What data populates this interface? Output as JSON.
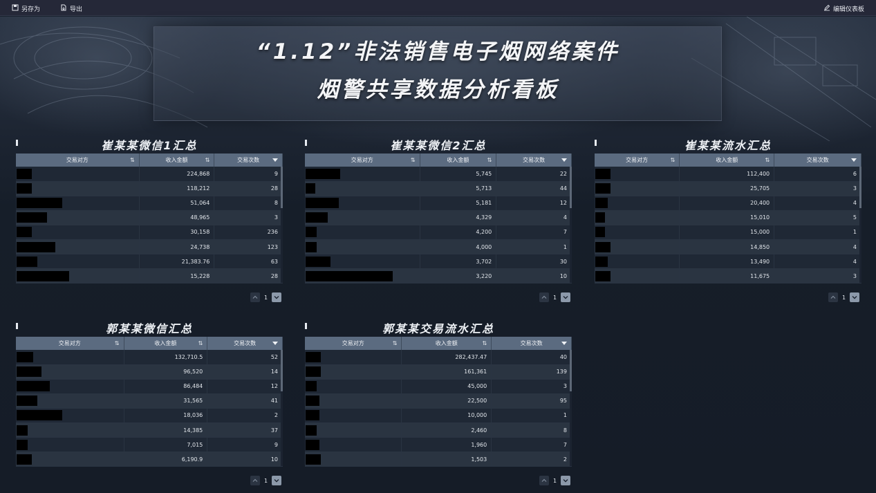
{
  "toolbar": {
    "save_as": "另存为",
    "export": "导出",
    "edit_dashboard": "编辑仪表板"
  },
  "title": {
    "line1": "“1.12”非法销售电子烟网络案件",
    "line2": "烟警共享数据分析看板"
  },
  "panels": [
    {
      "title": "崔某某微信1汇总",
      "columns": [
        "交易对方",
        "收入金额",
        "交易次数"
      ],
      "rows": [
        {
          "amount": "224,868",
          "count": "9"
        },
        {
          "amount": "118,212",
          "count": "28"
        },
        {
          "amount": "51,064",
          "count": "8"
        },
        {
          "amount": "48,965",
          "count": "3"
        },
        {
          "amount": "30,158",
          "count": "236"
        },
        {
          "amount": "24,738",
          "count": "123"
        },
        {
          "amount": "21,383.76",
          "count": "63"
        },
        {
          "amount": "15,228",
          "count": "28"
        }
      ],
      "page": "1"
    },
    {
      "title": "崔某某微信2汇总",
      "columns": [
        "交易对方",
        "收入金额",
        "交易次数"
      ],
      "rows": [
        {
          "amount": "5,745",
          "count": "22"
        },
        {
          "amount": "5,713",
          "count": "44"
        },
        {
          "amount": "5,181",
          "count": "12"
        },
        {
          "amount": "4,329",
          "count": "4"
        },
        {
          "amount": "4,200",
          "count": "7"
        },
        {
          "amount": "4,000",
          "count": "1"
        },
        {
          "amount": "3,702",
          "count": "30"
        },
        {
          "amount": "3,220",
          "count": "10"
        }
      ],
      "page": "1"
    },
    {
      "title": "崔某某流水汇总",
      "columns": [
        "交易对方",
        "收入金额",
        "交易次数"
      ],
      "rows": [
        {
          "amount": "112,400",
          "count": "6"
        },
        {
          "amount": "25,705",
          "count": "3"
        },
        {
          "amount": "20,400",
          "count": "4"
        },
        {
          "amount": "15,010",
          "count": "5"
        },
        {
          "amount": "15,000",
          "count": "1"
        },
        {
          "amount": "14,850",
          "count": "4"
        },
        {
          "amount": "13,490",
          "count": "4"
        },
        {
          "amount": "11,675",
          "count": "3"
        }
      ],
      "page": "1"
    },
    {
      "title": "郭某某微信汇总",
      "columns": [
        "交易对方",
        "收入金额",
        "交易次数"
      ],
      "rows": [
        {
          "amount": "132,710.5",
          "count": "52"
        },
        {
          "amount": "96,520",
          "count": "14"
        },
        {
          "amount": "86,484",
          "count": "12"
        },
        {
          "amount": "31,565",
          "count": "41"
        },
        {
          "amount": "18,036",
          "count": "2"
        },
        {
          "amount": "14,385",
          "count": "37"
        },
        {
          "amount": "7,015",
          "count": "9"
        },
        {
          "amount": "6,190.9",
          "count": "10"
        }
      ],
      "page": "1"
    },
    {
      "title": "郭某某交易流水汇总",
      "columns": [
        "交易对方",
        "收入金额",
        "交易次数"
      ],
      "rows": [
        {
          "amount": "282,437.47",
          "count": "40"
        },
        {
          "amount": "161,361",
          "count": "139"
        },
        {
          "amount": "45,000",
          "count": "3"
        },
        {
          "amount": "22,500",
          "count": "95"
        },
        {
          "amount": "10,000",
          "count": "1"
        },
        {
          "amount": "2,460",
          "count": "8"
        },
        {
          "amount": "1,960",
          "count": "7"
        },
        {
          "amount": "1,503",
          "count": "2"
        }
      ],
      "page": "1"
    }
  ]
}
